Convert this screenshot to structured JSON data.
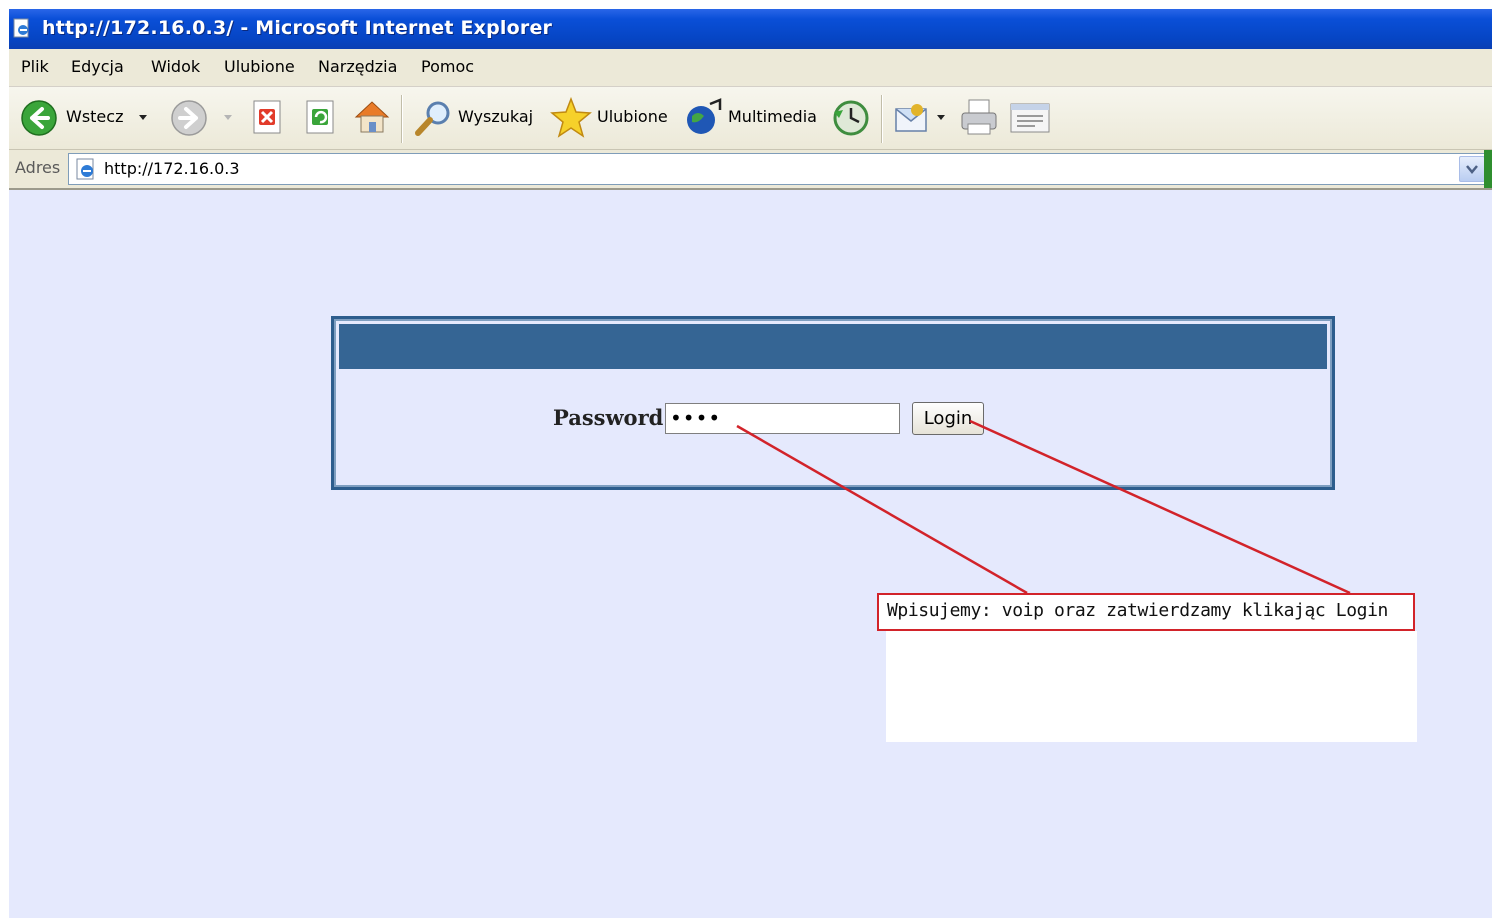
{
  "window": {
    "title": "http://172.16.0.3/ - Microsoft Internet Explorer"
  },
  "menu": {
    "items": [
      "Plik",
      "Edycja",
      "Widok",
      "Ulubione",
      "Narzędzia",
      "Pomoc"
    ]
  },
  "toolbar": {
    "back_label": "Wstecz",
    "search_label": "Wyszukaj",
    "favorites_label": "Ulubione",
    "media_label": "Multimedia"
  },
  "address": {
    "label": "Adres",
    "url": "http://172.16.0.3"
  },
  "login": {
    "password_label": "Password",
    "password_value": "••••",
    "login_button": "Login"
  },
  "annotation": {
    "text": "Wpisujemy: voip oraz zatwierdzamy klikając Login"
  },
  "colors": {
    "title_bar": "#0645c4",
    "page_background": "#e5e9fd",
    "panel_header": "#356594",
    "annotation_red": "#d2232a"
  }
}
